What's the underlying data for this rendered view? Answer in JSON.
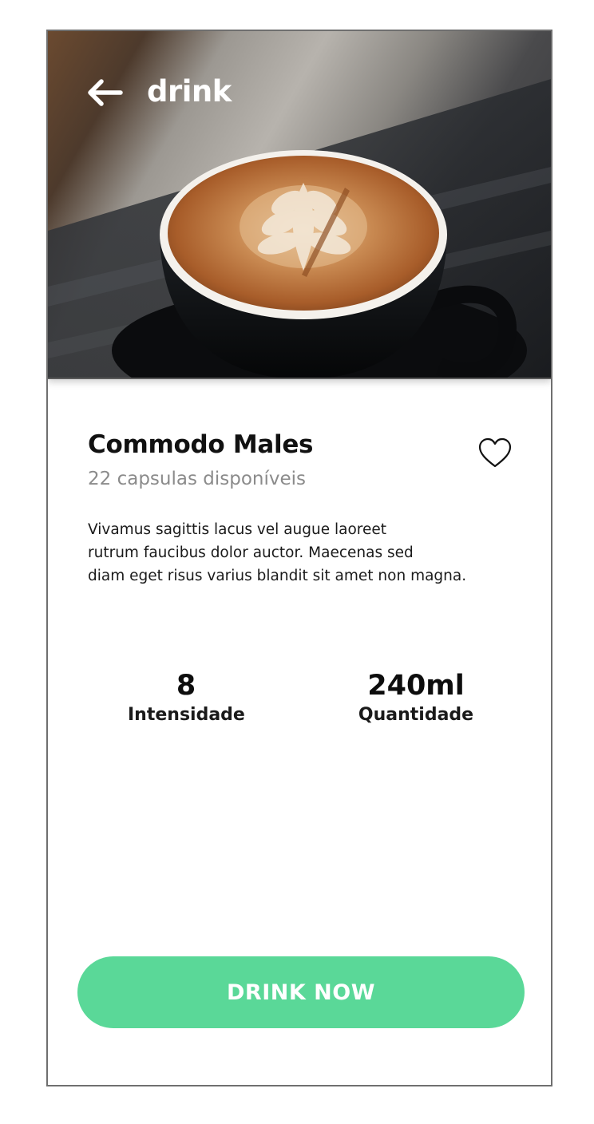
{
  "header": {
    "title": "drink",
    "back_icon": "arrow-left-icon",
    "image_subject": "latte-art-coffee-cup"
  },
  "product": {
    "name": "Commodo Males",
    "availability": "22 capsulas disponíveis",
    "favorite_icon": "heart-outline-icon",
    "description_lines": [
      "Vivamus sagittis lacus vel augue laoreet",
      "rutrum faucibus dolor auctor. Maecenas sed",
      "diam eget risus varius blandit sit amet non magna."
    ]
  },
  "stats": {
    "intensity": {
      "value": "8",
      "label": "Intensidade"
    },
    "quantity": {
      "value": "240ml",
      "label": "Quantidade"
    }
  },
  "cta": {
    "label": "DRINK NOW"
  },
  "colors": {
    "accent": "#5ad898",
    "subtitle": "#8b8b8b",
    "text": "#111111"
  }
}
